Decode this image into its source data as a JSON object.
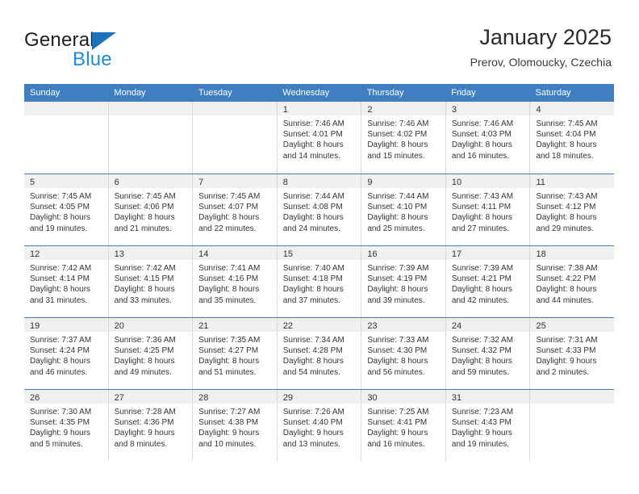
{
  "brand": {
    "name_top": "General",
    "name_bottom": "Blue",
    "accent_color": "#1b8bdb",
    "triangle_color": "#1b72bd"
  },
  "header": {
    "title": "January 2025",
    "location": "Prerov, Olomoucky, Czechia"
  },
  "calendar": {
    "header_color": "#3f7fc1",
    "weekdays": [
      "Sunday",
      "Monday",
      "Tuesday",
      "Wednesday",
      "Thursday",
      "Friday",
      "Saturday"
    ],
    "weeks": [
      [
        {
          "day": "",
          "lines": []
        },
        {
          "day": "",
          "lines": []
        },
        {
          "day": "",
          "lines": []
        },
        {
          "day": "1",
          "lines": [
            "Sunrise: 7:46 AM",
            "Sunset: 4:01 PM",
            "Daylight: 8 hours",
            "and 14 minutes."
          ]
        },
        {
          "day": "2",
          "lines": [
            "Sunrise: 7:46 AM",
            "Sunset: 4:02 PM",
            "Daylight: 8 hours",
            "and 15 minutes."
          ]
        },
        {
          "day": "3",
          "lines": [
            "Sunrise: 7:46 AM",
            "Sunset: 4:03 PM",
            "Daylight: 8 hours",
            "and 16 minutes."
          ]
        },
        {
          "day": "4",
          "lines": [
            "Sunrise: 7:45 AM",
            "Sunset: 4:04 PM",
            "Daylight: 8 hours",
            "and 18 minutes."
          ]
        }
      ],
      [
        {
          "day": "5",
          "lines": [
            "Sunrise: 7:45 AM",
            "Sunset: 4:05 PM",
            "Daylight: 8 hours",
            "and 19 minutes."
          ]
        },
        {
          "day": "6",
          "lines": [
            "Sunrise: 7:45 AM",
            "Sunset: 4:06 PM",
            "Daylight: 8 hours",
            "and 21 minutes."
          ]
        },
        {
          "day": "7",
          "lines": [
            "Sunrise: 7:45 AM",
            "Sunset: 4:07 PM",
            "Daylight: 8 hours",
            "and 22 minutes."
          ]
        },
        {
          "day": "8",
          "lines": [
            "Sunrise: 7:44 AM",
            "Sunset: 4:08 PM",
            "Daylight: 8 hours",
            "and 24 minutes."
          ]
        },
        {
          "day": "9",
          "lines": [
            "Sunrise: 7:44 AM",
            "Sunset: 4:10 PM",
            "Daylight: 8 hours",
            "and 25 minutes."
          ]
        },
        {
          "day": "10",
          "lines": [
            "Sunrise: 7:43 AM",
            "Sunset: 4:11 PM",
            "Daylight: 8 hours",
            "and 27 minutes."
          ]
        },
        {
          "day": "11",
          "lines": [
            "Sunrise: 7:43 AM",
            "Sunset: 4:12 PM",
            "Daylight: 8 hours",
            "and 29 minutes."
          ]
        }
      ],
      [
        {
          "day": "12",
          "lines": [
            "Sunrise: 7:42 AM",
            "Sunset: 4:14 PM",
            "Daylight: 8 hours",
            "and 31 minutes."
          ]
        },
        {
          "day": "13",
          "lines": [
            "Sunrise: 7:42 AM",
            "Sunset: 4:15 PM",
            "Daylight: 8 hours",
            "and 33 minutes."
          ]
        },
        {
          "day": "14",
          "lines": [
            "Sunrise: 7:41 AM",
            "Sunset: 4:16 PM",
            "Daylight: 8 hours",
            "and 35 minutes."
          ]
        },
        {
          "day": "15",
          "lines": [
            "Sunrise: 7:40 AM",
            "Sunset: 4:18 PM",
            "Daylight: 8 hours",
            "and 37 minutes."
          ]
        },
        {
          "day": "16",
          "lines": [
            "Sunrise: 7:39 AM",
            "Sunset: 4:19 PM",
            "Daylight: 8 hours",
            "and 39 minutes."
          ]
        },
        {
          "day": "17",
          "lines": [
            "Sunrise: 7:39 AM",
            "Sunset: 4:21 PM",
            "Daylight: 8 hours",
            "and 42 minutes."
          ]
        },
        {
          "day": "18",
          "lines": [
            "Sunrise: 7:38 AM",
            "Sunset: 4:22 PM",
            "Daylight: 8 hours",
            "and 44 minutes."
          ]
        }
      ],
      [
        {
          "day": "19",
          "lines": [
            "Sunrise: 7:37 AM",
            "Sunset: 4:24 PM",
            "Daylight: 8 hours",
            "and 46 minutes."
          ]
        },
        {
          "day": "20",
          "lines": [
            "Sunrise: 7:36 AM",
            "Sunset: 4:25 PM",
            "Daylight: 8 hours",
            "and 49 minutes."
          ]
        },
        {
          "day": "21",
          "lines": [
            "Sunrise: 7:35 AM",
            "Sunset: 4:27 PM",
            "Daylight: 8 hours",
            "and 51 minutes."
          ]
        },
        {
          "day": "22",
          "lines": [
            "Sunrise: 7:34 AM",
            "Sunset: 4:28 PM",
            "Daylight: 8 hours",
            "and 54 minutes."
          ]
        },
        {
          "day": "23",
          "lines": [
            "Sunrise: 7:33 AM",
            "Sunset: 4:30 PM",
            "Daylight: 8 hours",
            "and 56 minutes."
          ]
        },
        {
          "day": "24",
          "lines": [
            "Sunrise: 7:32 AM",
            "Sunset: 4:32 PM",
            "Daylight: 8 hours",
            "and 59 minutes."
          ]
        },
        {
          "day": "25",
          "lines": [
            "Sunrise: 7:31 AM",
            "Sunset: 4:33 PM",
            "Daylight: 9 hours",
            "and 2 minutes."
          ]
        }
      ],
      [
        {
          "day": "26",
          "lines": [
            "Sunrise: 7:30 AM",
            "Sunset: 4:35 PM",
            "Daylight: 9 hours",
            "and 5 minutes."
          ]
        },
        {
          "day": "27",
          "lines": [
            "Sunrise: 7:28 AM",
            "Sunset: 4:36 PM",
            "Daylight: 9 hours",
            "and 8 minutes."
          ]
        },
        {
          "day": "28",
          "lines": [
            "Sunrise: 7:27 AM",
            "Sunset: 4:38 PM",
            "Daylight: 9 hours",
            "and 10 minutes."
          ]
        },
        {
          "day": "29",
          "lines": [
            "Sunrise: 7:26 AM",
            "Sunset: 4:40 PM",
            "Daylight: 9 hours",
            "and 13 minutes."
          ]
        },
        {
          "day": "30",
          "lines": [
            "Sunrise: 7:25 AM",
            "Sunset: 4:41 PM",
            "Daylight: 9 hours",
            "and 16 minutes."
          ]
        },
        {
          "day": "31",
          "lines": [
            "Sunrise: 7:23 AM",
            "Sunset: 4:43 PM",
            "Daylight: 9 hours",
            "and 19 minutes."
          ]
        },
        {
          "day": "",
          "lines": []
        }
      ]
    ]
  }
}
